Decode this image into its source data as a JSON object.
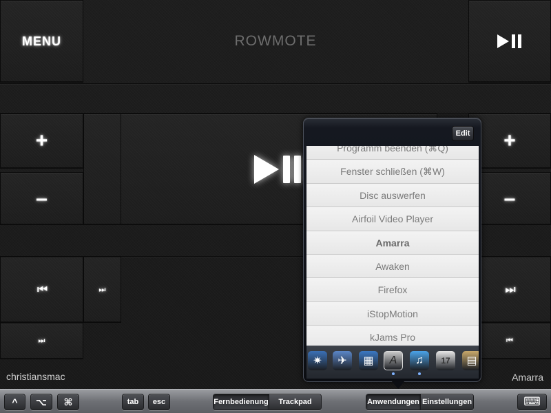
{
  "app": {
    "title": "ROWMOTE"
  },
  "remote": {
    "menu_label": "MENU",
    "play_pause_symbol": "▶❚❚",
    "volume_up_symbol": "+",
    "volume_down_symbol": "–",
    "prev_symbol": "⏮",
    "next_symbol": "⏭",
    "skip_small_symbol": "⏭",
    "prev_small_symbol": "⏮"
  },
  "status": {
    "device_name": "christiansmac",
    "current_app": "Amarra"
  },
  "popover": {
    "edit_label": "Edit",
    "items": [
      {
        "label": "Programm beenden (⌘Q)",
        "bold": false
      },
      {
        "label": "Fenster schließen (⌘W)",
        "bold": false
      },
      {
        "label": "Disc auswerfen",
        "bold": false
      },
      {
        "label": "Airfoil Video Player",
        "bold": false
      },
      {
        "label": "Amarra",
        "bold": true
      },
      {
        "label": "Awaken",
        "bold": false
      },
      {
        "label": "Firefox",
        "bold": false
      },
      {
        "label": "iStopMotion",
        "bold": false
      },
      {
        "label": "kJams Pro",
        "bold": false
      }
    ],
    "dock_icons": [
      {
        "name": "safari-icon",
        "glyph": "✷",
        "color": "#3a6fb5"
      },
      {
        "name": "mail-stamp-icon",
        "glyph": "✈",
        "color": "#5a86c8"
      },
      {
        "name": "finder-icon",
        "glyph": "▦",
        "color": "#3b78c4"
      },
      {
        "name": "script-editor-icon",
        "glyph": "A",
        "color": "#c9c9c9"
      },
      {
        "name": "itunes-icon",
        "glyph": "♫",
        "color": "#4aa3e8"
      },
      {
        "name": "ical-icon",
        "glyph": "17",
        "color": "#e8e8e8"
      },
      {
        "name": "notes-icon",
        "glyph": "▤",
        "color": "#c8a86a"
      }
    ],
    "calendar_day": "17"
  },
  "toolbar": {
    "ctrl_symbol": "^",
    "option_symbol": "⌥",
    "command_symbol": "⌘",
    "tab_label": "tab",
    "esc_label": "esc",
    "mode_tabs": [
      {
        "label": "Fernbedienung",
        "selected": true
      },
      {
        "label": "Trackpad",
        "selected": false
      }
    ],
    "section_tabs": [
      {
        "label": "Anwendungen",
        "selected": true
      },
      {
        "label": "Einstellungen",
        "selected": false
      }
    ],
    "keyboard_icon": "⌨"
  }
}
